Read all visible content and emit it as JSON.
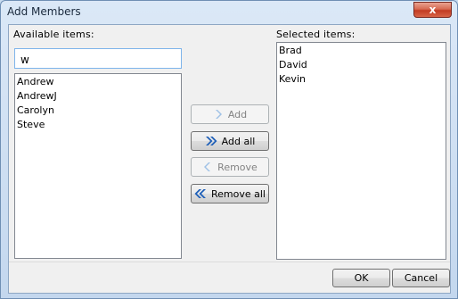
{
  "window": {
    "title": "Add Members",
    "close_label": "x"
  },
  "available": {
    "label": "Available items:",
    "filter_value": "w",
    "items": [
      "Andrew",
      "AndrewJ",
      "Carolyn",
      "Steve"
    ]
  },
  "selected": {
    "label": "Selected items:",
    "items": [
      "Brad",
      "David",
      "Kevin"
    ]
  },
  "buttons": {
    "add": "Add",
    "add_all": "Add all",
    "remove": "Remove",
    "remove_all": "Remove all",
    "ok": "OK",
    "cancel": "Cancel"
  },
  "colors": {
    "arrow_enabled": "#1e5fb8",
    "arrow_disabled": "#9fc1e6"
  },
  "icons": {
    "add": "chevron-right-icon",
    "add_all": "double-chevron-right-icon",
    "remove": "chevron-left-icon",
    "remove_all": "double-chevron-left-icon"
  }
}
